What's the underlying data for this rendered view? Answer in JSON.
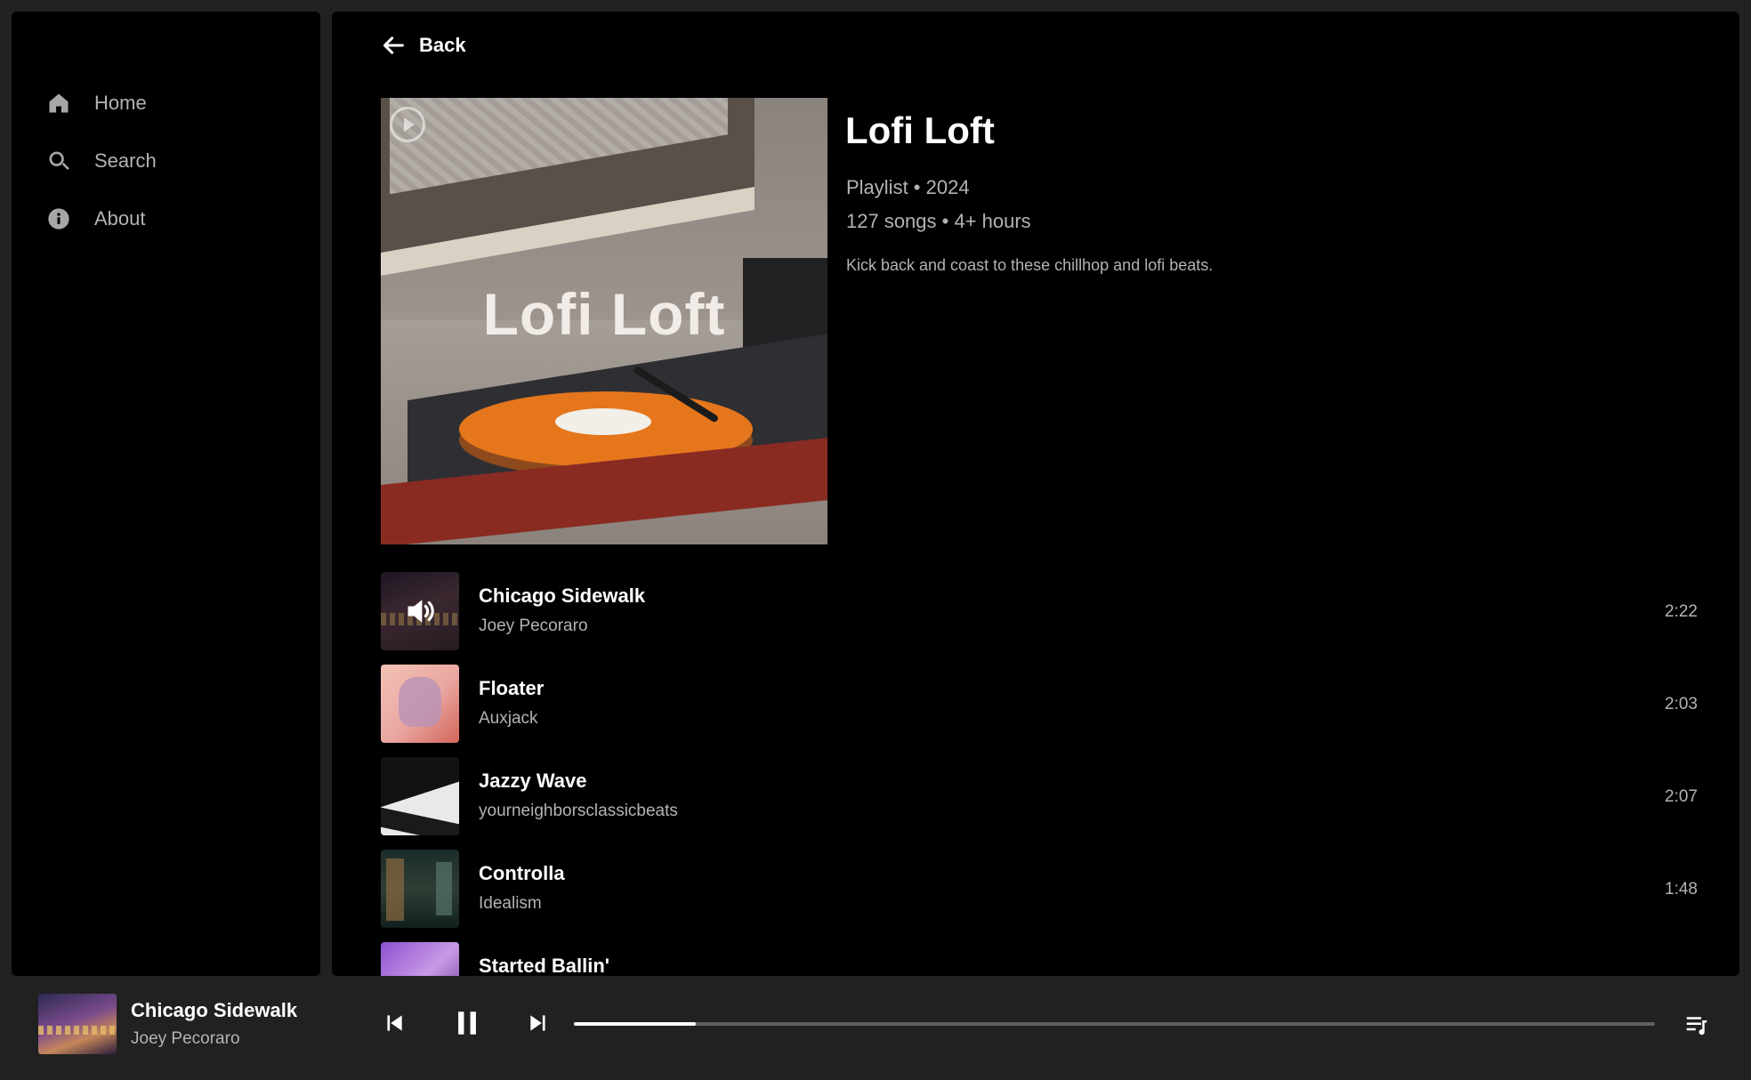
{
  "sidebar": {
    "items": [
      {
        "label": "Home",
        "icon": "home-icon"
      },
      {
        "label": "Search",
        "icon": "search-icon"
      },
      {
        "label": "About",
        "icon": "info-icon"
      }
    ]
  },
  "header": {
    "back_label": "Back"
  },
  "playlist": {
    "cover_text": "Lofi Loft",
    "title": "Lofi Loft",
    "type_year": "Playlist • 2024",
    "stats": "127 songs • 4+ hours",
    "description": "Kick back and coast to these chillhop and lofi beats."
  },
  "tracks": [
    {
      "name": "Chicago Sidewalk",
      "artist": "Joey Pecoraro",
      "duration": "2:22",
      "playing": true
    },
    {
      "name": "Floater",
      "artist": "Auxjack",
      "duration": "2:03"
    },
    {
      "name": "Jazzy Wave",
      "artist": "yourneighborsclassicbeats",
      "duration": "2:07"
    },
    {
      "name": "Controlla",
      "artist": "Idealism",
      "duration": "1:48"
    },
    {
      "name": "Started Ballin'",
      "artist": "",
      "duration": ""
    }
  ],
  "player": {
    "title": "Chicago Sidewalk",
    "artist": "Joey Pecoraro",
    "progress_fraction": 0.113
  },
  "colors": {
    "background": "#000000",
    "chrome": "#212121",
    "muted_text": "#b3b3b3",
    "progress_track": "#5e5e5e"
  }
}
